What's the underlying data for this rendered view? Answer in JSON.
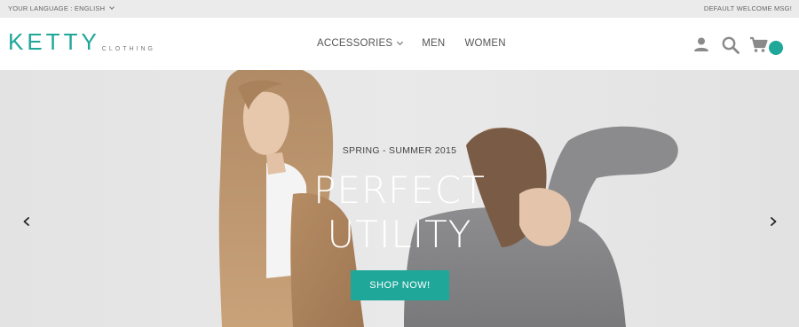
{
  "topbar": {
    "language_label": "YOUR LANGUAGE : ENGLISH",
    "welcome_msg": "DEFAULT WELCOME MSG!"
  },
  "header": {
    "logo_main": "KETTY",
    "logo_sub": "CLOTHING",
    "nav": [
      "ACCESSORIES",
      "MEN",
      "WOMEN"
    ],
    "icons": [
      "user-icon",
      "search-icon",
      "cart-icon"
    ]
  },
  "hero": {
    "season": "SPRING - SUMMER 2015",
    "headline_line1": "PERFECT",
    "headline_line2": "UTILITY",
    "cta_label": "SHOP NOW!"
  },
  "colors": {
    "accent": "#1fa79a",
    "topbar_bg": "#ebebeb",
    "hero_bg": "#e6e6e6"
  }
}
